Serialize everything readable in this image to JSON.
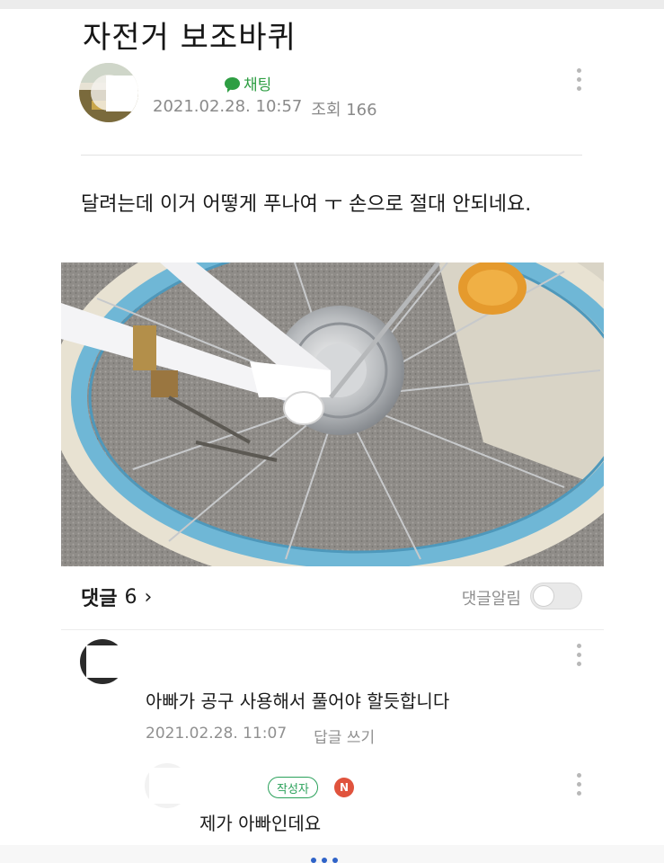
{
  "post": {
    "title": "자전거 보조바퀴",
    "chat_label": "채팅",
    "date": "2021.02.28. 10:57",
    "views": "조회 166",
    "body": "달려는데 이거 어떻게 푸나여 ㅜ 손으로 절대 안되네요.",
    "more_icon": "vertical-ellipsis"
  },
  "comments_bar": {
    "label": "댓글",
    "count": "6",
    "chevron": "›",
    "alert_label": "댓글알림",
    "alert_enabled": false
  },
  "comments": [
    {
      "text": "아빠가 공구 사용해서 풀어야 할듯합니다",
      "date": "2021.02.28. 11:07",
      "reply_label": "답글 쓰기"
    },
    {
      "author_badge": "작성자",
      "n_badge": "N",
      "text": "제가 아빠인데요"
    }
  ],
  "colors": {
    "accent_green": "#2e9e43",
    "badge_red": "#e0533d",
    "meta_gray": "#8a8a8a"
  }
}
